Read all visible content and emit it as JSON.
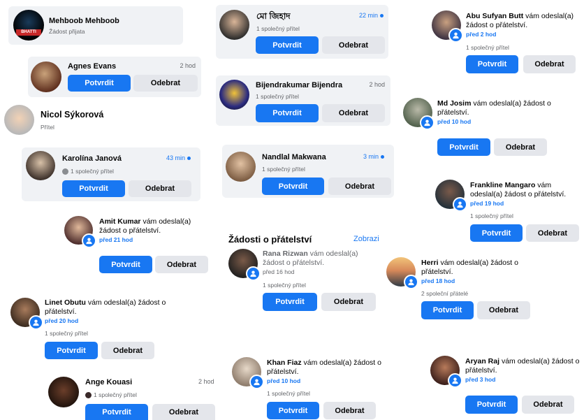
{
  "buttons": {
    "confirm": "Potvrdit",
    "remove": "Odebrat"
  },
  "texts": {
    "sent_request": "vám odeslal(a) žádost o přátelství.",
    "mutual_1": "1 společný přítel",
    "mutual_2": "2 společní přátelé",
    "friend": "Přítel",
    "request_accepted": "Žádost přijata"
  },
  "section": {
    "title": "Žádosti o přátelství",
    "link": "Zobrazi"
  },
  "cards": [
    {
      "name": "Mehboob Mehboob",
      "status": "Žádost přijata"
    },
    {
      "name": "Agnes Evans",
      "time": "2 hod"
    },
    {
      "name": "Nicol Sýkorová",
      "status": "Přítel"
    },
    {
      "name": "Karolína Janová",
      "time": "43 min",
      "mutual": "1 společný přítel"
    },
    {
      "name": "Amit Kumar",
      "text": "vám odeslal(a) žádost o přátelství.",
      "time": "před 21 hod"
    },
    {
      "name": "Linet Obutu",
      "text": "vám odeslal(a) žádost o přátelství.",
      "time": "před 20 hod",
      "mutual": "1 společný přítel"
    },
    {
      "name": "Ange Kouasi",
      "time": "2 hod",
      "mutual": "1 společný přítel"
    },
    {
      "name": "মো জিহাদ",
      "time": "22 min",
      "mutual": "1 společný přítel"
    },
    {
      "name": "Bijendrakumar Bijendra",
      "time": "2 hod",
      "mutual": "1 společný přítel"
    },
    {
      "name": "Nandlal Makwana",
      "time": "3 min",
      "mutual": "1 společný přítel"
    },
    {
      "name": "Rana Rizwan",
      "text": "vám odeslal(a) žádost o přátelství.",
      "time": "před 16 hod",
      "mutual": "1 společný přítel"
    },
    {
      "name": "Khan Fiaz",
      "text": "vám odeslal(a) žádost o přátelství.",
      "time": "před 10 hod",
      "mutual": "1 společný přítel"
    },
    {
      "name": "Abu Sufyan Butt",
      "text": "vám odeslal(a) žádost o přátelství.",
      "time": "před 2 hod",
      "mutual": "1 společný přítel"
    },
    {
      "name": "Md Josim",
      "text": "vám odeslal(a) žádost o přátelství.",
      "time": "před 10 hod"
    },
    {
      "name": "Frankline Mangaro",
      "text": "vám odeslal(a) žádost o přátelství.",
      "time": "před 19 hod",
      "mutual": "1 společný přítel"
    },
    {
      "name": "Herri",
      "text": "vám odeslal(a) žádost o přátelství.",
      "time": "před 18 hod",
      "mutual": "2 společní přátelé"
    },
    {
      "name": "Aryan Raj",
      "text": "vám odeslal(a) žádost o přátelství.",
      "time": "před 3 hod"
    }
  ],
  "colors": {
    "accent": "#1877f2",
    "card_bg": "#f0f2f5",
    "secondary_btn": "#e4e6eb"
  }
}
